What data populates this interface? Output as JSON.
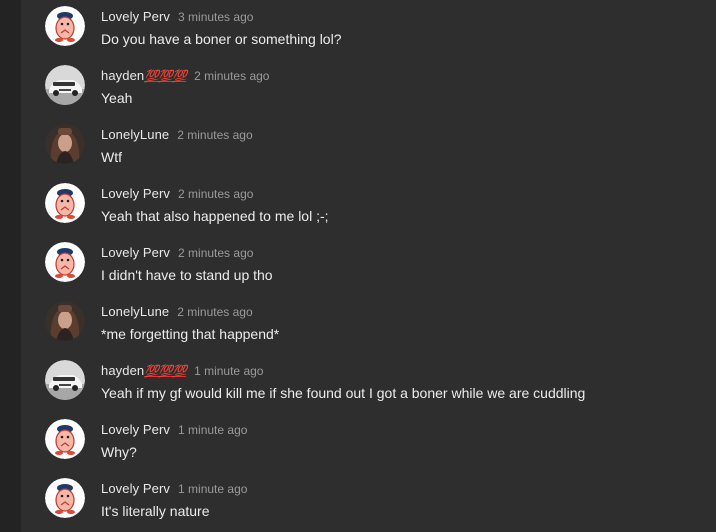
{
  "messages": [
    {
      "author": "Lovely Perv",
      "emoji": "",
      "time": "3 minutes ago",
      "text": "Do you have a boner or something lol?",
      "avatar": "penguin-avatar"
    },
    {
      "author": "hayden",
      "emoji": "💯💯💯",
      "time": "2 minutes ago",
      "text": "Yeah",
      "avatar": "car-avatar"
    },
    {
      "author": "LonelyLune",
      "emoji": "",
      "time": "2 minutes ago",
      "text": "Wtf",
      "avatar": "girl-avatar"
    },
    {
      "author": "Lovely Perv",
      "emoji": "",
      "time": "2 minutes ago",
      "text": "Yeah that also happened to me lol ;-;",
      "avatar": "penguin-avatar"
    },
    {
      "author": "Lovely Perv",
      "emoji": "",
      "time": "2 minutes ago",
      "text": "I didn't have to stand up tho",
      "avatar": "penguin-avatar"
    },
    {
      "author": "LonelyLune",
      "emoji": "",
      "time": "2 minutes ago",
      "text": "*me forgetting that happend*",
      "avatar": "girl-avatar"
    },
    {
      "author": "hayden",
      "emoji": "💯💯💯",
      "time": "1 minute ago",
      "text": "Yeah if my gf would kill me if she found out I got a boner while we are cuddling",
      "avatar": "car-avatar"
    },
    {
      "author": "Lovely Perv",
      "emoji": "",
      "time": "1 minute ago",
      "text": "Why?",
      "avatar": "penguin-avatar"
    },
    {
      "author": "Lovely Perv",
      "emoji": "",
      "time": "1 minute ago",
      "text": "It's literally nature",
      "avatar": "penguin-avatar"
    }
  ],
  "colors": {
    "background": "#2e2e2e",
    "author": "#e8e8e8",
    "timestamp": "#9a9a9a",
    "text": "#ececec"
  }
}
